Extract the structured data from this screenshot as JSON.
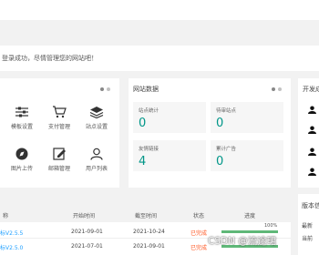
{
  "welcome": {
    "message": "登录成功，尽情管理您的网站吧！"
  },
  "tools": {
    "items": [
      {
        "label": "模板设置",
        "icon": "sliders-icon"
      },
      {
        "label": "支付管理",
        "icon": "cart-icon"
      },
      {
        "label": "站点设置",
        "icon": "layers-icon"
      },
      {
        "label": "图片上传",
        "icon": "compass-icon"
      },
      {
        "label": "邮箱管理",
        "icon": "edit-icon"
      },
      {
        "label": "用户列表",
        "icon": "user-icon"
      }
    ]
  },
  "stats": {
    "title": "网站数据",
    "items": [
      {
        "label": "站点统计",
        "value": "0"
      },
      {
        "label": "待审站点",
        "value": "0"
      },
      {
        "label": "友情链接",
        "value": "4"
      },
      {
        "label": "累计广告",
        "value": "0"
      }
    ]
  },
  "side": {
    "title": "开发成"
  },
  "side2": {
    "title": "版本信",
    "sub": "最新",
    "sub2": "当前"
  },
  "table": {
    "headers": [
      "称",
      "开始时间",
      "截至时间",
      "状态",
      "进度"
    ],
    "rows": [
      {
        "name": "标V2.5.5",
        "start": "2021-09-01",
        "end": "2021-10-24",
        "status": "已完成",
        "progress": 1.0,
        "progress_label": "100%"
      },
      {
        "name": "标V2.5.0",
        "start": "2021-07-01",
        "end": "2021-09-01",
        "status": "已完成",
        "progress": 1.0,
        "progress_label": ""
      }
    ]
  },
  "watermark": "CSDN @流途珺",
  "colors": {
    "accent": "#009688",
    "link": "#1e9fff",
    "status_done": "#ff5722",
    "progress": "#5fb878"
  }
}
